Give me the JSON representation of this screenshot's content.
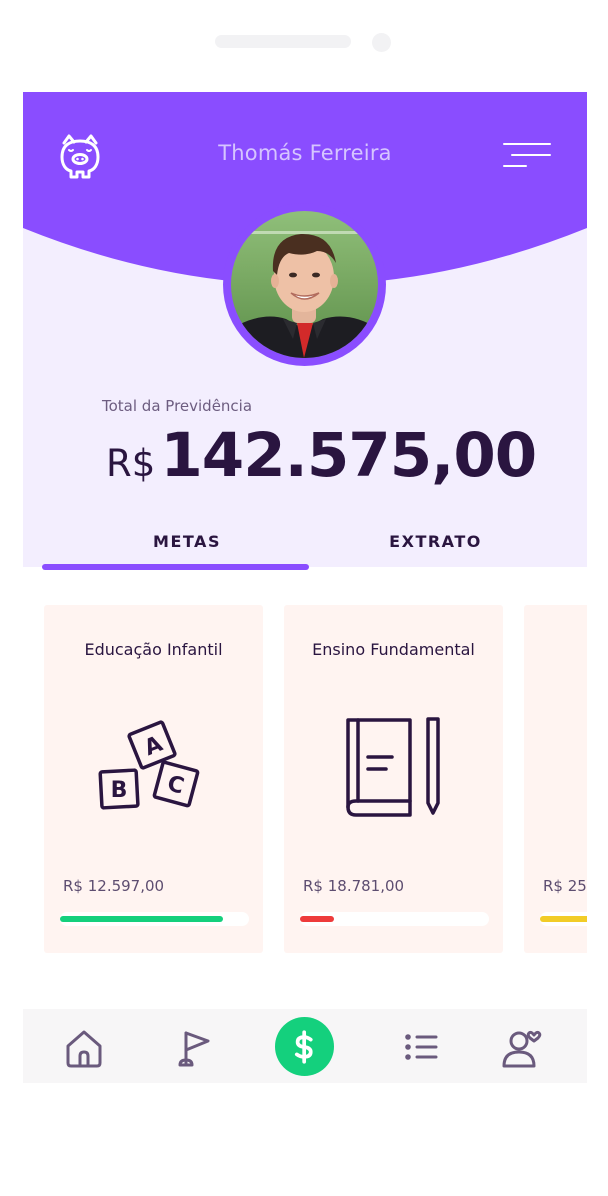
{
  "header": {
    "user_name": "Thomás Ferreira",
    "brand_color": "#8a4dff",
    "piggy_icon": "piggy-bank-icon",
    "menu_icon": "hamburger-menu-icon"
  },
  "balance": {
    "label": "Total da Previdência",
    "currency": "R$",
    "amount": "142.575,00"
  },
  "tabs": [
    {
      "label": "METAS",
      "active": true
    },
    {
      "label": "EXTRATO",
      "active": false
    }
  ],
  "goals": [
    {
      "title": "Educação Infantil",
      "icon": "abc-blocks-icon",
      "amount": "R$ 12.597,00",
      "progress": 0.86,
      "color": "#14d07d"
    },
    {
      "title": "Ensino Fundamental",
      "icon": "book-pencil-icon",
      "amount": "R$ 18.781,00",
      "progress": 0.18,
      "color": "#ee3b3b"
    },
    {
      "title": "",
      "icon": "",
      "amount": "R$ 25",
      "progress": 0.3,
      "color": "#f2cc27"
    }
  ],
  "bottom_nav": {
    "items": [
      "home-icon",
      "flag-icon",
      "dollar-icon",
      "list-icon",
      "user-heart-icon"
    ],
    "accent": "#14d07d"
  }
}
